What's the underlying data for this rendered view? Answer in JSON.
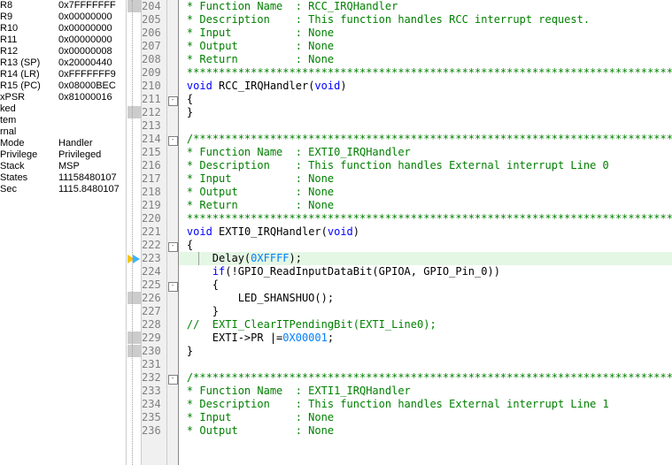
{
  "registers": [
    {
      "name": "R8",
      "value": "0x7FFFFFFF"
    },
    {
      "name": "R9",
      "value": "0x00000000"
    },
    {
      "name": "R10",
      "value": "0x00000000"
    },
    {
      "name": "R11",
      "value": "0x00000000"
    },
    {
      "name": "R12",
      "value": "0x00000008"
    },
    {
      "name": "R13 (SP)",
      "value": "0x20000440"
    },
    {
      "name": "R14 (LR)",
      "value": "0xFFFFFFF9"
    },
    {
      "name": "R15 (PC)",
      "value": "0x08000BEC"
    },
    {
      "name": "xPSR",
      "value": "0x81000016"
    },
    {
      "name": "ked",
      "value": ""
    },
    {
      "name": "tem",
      "value": ""
    },
    {
      "name": "rnal",
      "value": ""
    },
    {
      "name": "Mode",
      "value": "Handler"
    },
    {
      "name": "Privilege",
      "value": "Privileged"
    },
    {
      "name": "Stack",
      "value": "MSP"
    },
    {
      "name": "States",
      "value": "11158480107"
    },
    {
      "name": "Sec",
      "value": "1115.8480107"
    }
  ],
  "code": {
    "lines": [
      {
        "n": 204,
        "bp": true,
        "fold": "",
        "cls": "",
        "segs": [
          {
            "t": " * Function Name  : RCC_IRQHandler",
            "c": "c-comment"
          }
        ]
      },
      {
        "n": 205,
        "bp": false,
        "fold": "",
        "cls": "",
        "segs": [
          {
            "t": " * Description    : This function handles RCC interrupt request.",
            "c": "c-comment"
          }
        ]
      },
      {
        "n": 206,
        "bp": false,
        "fold": "",
        "cls": "",
        "segs": [
          {
            "t": " * Input          : None",
            "c": "c-comment"
          }
        ]
      },
      {
        "n": 207,
        "bp": false,
        "fold": "",
        "cls": "",
        "segs": [
          {
            "t": " * Output         : None",
            "c": "c-comment"
          }
        ]
      },
      {
        "n": 208,
        "bp": false,
        "fold": "",
        "cls": "",
        "segs": [
          {
            "t": " * Return         : None",
            "c": "c-comment"
          }
        ]
      },
      {
        "n": 209,
        "bp": false,
        "fold": "",
        "cls": "",
        "segs": [
          {
            "t": " *******************************************************************************/",
            "c": "c-comment"
          }
        ]
      },
      {
        "n": 210,
        "bp": false,
        "fold": "",
        "cls": "",
        "segs": [
          {
            "t": " ",
            "c": ""
          },
          {
            "t": "void",
            "c": "c-keyword"
          },
          {
            "t": " RCC_IRQHandler(",
            "c": ""
          },
          {
            "t": "void",
            "c": "c-keyword"
          },
          {
            "t": ")",
            "c": ""
          }
        ]
      },
      {
        "n": 211,
        "bp": false,
        "fold": "box",
        "cls": "",
        "segs": [
          {
            "t": " {",
            "c": ""
          }
        ]
      },
      {
        "n": 212,
        "bp": true,
        "fold": "",
        "cls": "",
        "segs": [
          {
            "t": " }",
            "c": ""
          }
        ]
      },
      {
        "n": 213,
        "bp": false,
        "fold": "",
        "cls": "",
        "segs": [
          {
            "t": "",
            "c": ""
          }
        ]
      },
      {
        "n": 214,
        "bp": false,
        "fold": "box",
        "cls": "",
        "segs": [
          {
            "t": " /*******************************************************************************",
            "c": "c-comment"
          }
        ]
      },
      {
        "n": 215,
        "bp": false,
        "fold": "",
        "cls": "",
        "segs": [
          {
            "t": " * Function Name  : EXTI0_IRQHandler",
            "c": "c-comment"
          }
        ]
      },
      {
        "n": 216,
        "bp": false,
        "fold": "",
        "cls": "",
        "segs": [
          {
            "t": " * Description    : This function handles External interrupt Line 0",
            "c": "c-comment"
          }
        ]
      },
      {
        "n": 217,
        "bp": false,
        "fold": "",
        "cls": "",
        "segs": [
          {
            "t": " * Input          : None",
            "c": "c-comment"
          }
        ]
      },
      {
        "n": 218,
        "bp": false,
        "fold": "",
        "cls": "",
        "segs": [
          {
            "t": " * Output         : None",
            "c": "c-comment"
          }
        ]
      },
      {
        "n": 219,
        "bp": false,
        "fold": "",
        "cls": "",
        "segs": [
          {
            "t": " * Return         : None",
            "c": "c-comment"
          }
        ]
      },
      {
        "n": 220,
        "bp": false,
        "fold": "",
        "cls": "",
        "segs": [
          {
            "t": " *******************************************************************************/",
            "c": "c-comment"
          }
        ]
      },
      {
        "n": 221,
        "bp": false,
        "fold": "",
        "cls": "",
        "segs": [
          {
            "t": " ",
            "c": ""
          },
          {
            "t": "void",
            "c": "c-keyword"
          },
          {
            "t": " EXTI0_IRQHandler(",
            "c": ""
          },
          {
            "t": "void",
            "c": "c-keyword"
          },
          {
            "t": ")",
            "c": ""
          }
        ]
      },
      {
        "n": 222,
        "bp": false,
        "fold": "box",
        "cls": "",
        "segs": [
          {
            "t": " {",
            "c": ""
          }
        ]
      },
      {
        "n": 223,
        "bp": false,
        "fold": "",
        "cls": "hl",
        "segs": [
          {
            "t": "     Delay(",
            "c": ""
          },
          {
            "t": "0XFFFF",
            "c": "c-number"
          },
          {
            "t": ");",
            "c": ""
          }
        ],
        "cursor": true
      },
      {
        "n": 224,
        "bp": false,
        "fold": "",
        "cls": "",
        "segs": [
          {
            "t": "     ",
            "c": ""
          },
          {
            "t": "if",
            "c": "c-keyword"
          },
          {
            "t": "(!GPIO_ReadInputDataBit(GPIOA, GPIO_Pin_0))",
            "c": ""
          }
        ]
      },
      {
        "n": 225,
        "bp": false,
        "fold": "box",
        "cls": "",
        "segs": [
          {
            "t": "     {",
            "c": ""
          }
        ]
      },
      {
        "n": 226,
        "bp": true,
        "fold": "",
        "cls": "",
        "segs": [
          {
            "t": "         LED_SHANSHUO();",
            "c": ""
          }
        ]
      },
      {
        "n": 227,
        "bp": false,
        "fold": "",
        "cls": "",
        "segs": [
          {
            "t": "     }",
            "c": ""
          }
        ]
      },
      {
        "n": 228,
        "bp": false,
        "fold": "",
        "cls": "",
        "segs": [
          {
            "t": " //  EXTI_ClearITPendingBit(EXTI_Line0);",
            "c": "c-comment"
          }
        ]
      },
      {
        "n": 229,
        "bp": true,
        "fold": "",
        "cls": "",
        "segs": [
          {
            "t": "     EXTI->PR |=",
            "c": ""
          },
          {
            "t": "0X00001",
            "c": "c-number"
          },
          {
            "t": ";",
            "c": ""
          }
        ]
      },
      {
        "n": 230,
        "bp": true,
        "fold": "",
        "cls": "",
        "segs": [
          {
            "t": " }",
            "c": ""
          }
        ]
      },
      {
        "n": 231,
        "bp": false,
        "fold": "",
        "cls": "",
        "segs": [
          {
            "t": "",
            "c": ""
          }
        ]
      },
      {
        "n": 232,
        "bp": false,
        "fold": "box",
        "cls": "",
        "segs": [
          {
            "t": " /*******************************************************************************",
            "c": "c-comment"
          }
        ]
      },
      {
        "n": 233,
        "bp": false,
        "fold": "",
        "cls": "",
        "segs": [
          {
            "t": " * Function Name  : EXTI1_IRQHandler",
            "c": "c-comment"
          }
        ]
      },
      {
        "n": 234,
        "bp": false,
        "fold": "",
        "cls": "",
        "segs": [
          {
            "t": " * Description    : This function handles External interrupt Line 1",
            "c": "c-comment"
          }
        ]
      },
      {
        "n": 235,
        "bp": false,
        "fold": "",
        "cls": "",
        "segs": [
          {
            "t": " * Input          : None",
            "c": "c-comment"
          }
        ]
      },
      {
        "n": 236,
        "bp": false,
        "fold": "",
        "cls": "",
        "segs": [
          {
            "t": " * Output         : None",
            "c": "c-comment"
          }
        ]
      }
    ]
  }
}
